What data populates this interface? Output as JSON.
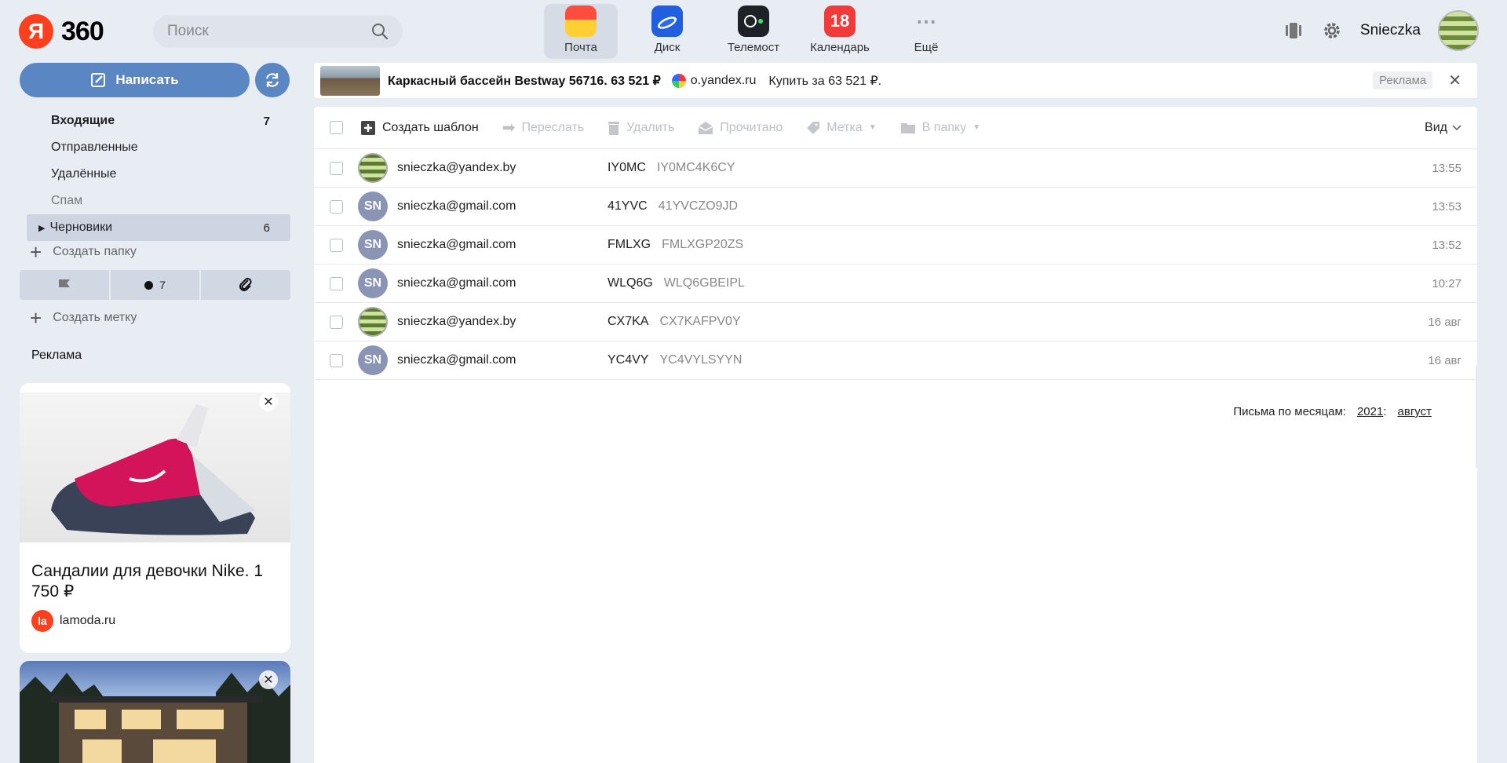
{
  "header": {
    "logo_letter": "Я",
    "logo_text": "360",
    "search_placeholder": "Поиск",
    "apps": [
      {
        "label": "Почта",
        "color": "#ff5a3c",
        "active": true
      },
      {
        "label": "Диск",
        "color": "#2a6bf0"
      },
      {
        "label": "Телемост",
        "color": "#1d2226"
      },
      {
        "label": "Календарь",
        "badge": "18",
        "color": "#f23a3a"
      },
      {
        "label": "Ещё",
        "color": "#cccccc"
      }
    ],
    "username": "Snieczka"
  },
  "sidebar": {
    "compose_label": "Написать",
    "folders": [
      {
        "label": "Входящие",
        "count": "7"
      },
      {
        "label": "Отправленные",
        "count": ""
      },
      {
        "label": "Удалённые",
        "count": ""
      },
      {
        "label": "Спам",
        "count": ""
      },
      {
        "label": "Черновики",
        "count": "6"
      }
    ],
    "create_folder": "Создать папку",
    "labels_unread_count": "7",
    "create_label": "Создать метку",
    "ads_heading": "Реклама",
    "ad1": {
      "title": "Сандалии для девочки Nike. 1 750 ₽",
      "domain": "lamoda.ru",
      "logo_text": "la"
    }
  },
  "banner": {
    "title": "Каркасный бассейн Bestway 56716. 63 521 ₽",
    "domain": "o.yandex.ru",
    "buy": "Купить за 63 521 ₽.",
    "tag": "Реклама"
  },
  "toolbar": {
    "create_template": "Создать шаблон",
    "forward": "Переслать",
    "delete": "Удалить",
    "read": "Прочитано",
    "label": "Метка",
    "to_folder": "В папку",
    "view": "Вид"
  },
  "messages": [
    {
      "from": "snieczka@yandex.by",
      "avatar": "img",
      "subject": "IY0MC",
      "snippet": "IY0MC4K6CY",
      "time": "13:55"
    },
    {
      "from": "snieczka@gmail.com",
      "avatar": "SN",
      "subject": "41YVC",
      "snippet": "41YVCZO9JD",
      "time": "13:53"
    },
    {
      "from": "snieczka@gmail.com",
      "avatar": "SN",
      "subject": "FMLXG",
      "snippet": "FMLXGP20ZS",
      "time": "13:52"
    },
    {
      "from": "snieczka@gmail.com",
      "avatar": "SN",
      "subject": "WLQ6G",
      "snippet": "WLQ6GBEIPL",
      "time": "10:27"
    },
    {
      "from": "snieczka@yandex.by",
      "avatar": "img",
      "subject": "CX7KA",
      "snippet": "CX7KAFPV0Y",
      "time": "16 авг"
    },
    {
      "from": "snieczka@gmail.com",
      "avatar": "SN",
      "subject": "YC4VY",
      "snippet": "YC4VYLSYYN",
      "time": "16 авг"
    }
  ],
  "months": {
    "label": "Письма по месяцам:",
    "year": "2021",
    "month": "август"
  }
}
